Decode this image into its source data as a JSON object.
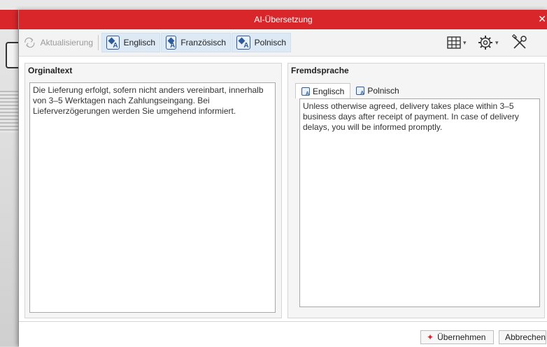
{
  "dialog": {
    "title": "AI-Übersetzung",
    "close_glyph": "✕"
  },
  "toolbar": {
    "refresh_label": "Aktualisierung",
    "languages": [
      {
        "label": "Englisch"
      },
      {
        "label": "Französisch"
      },
      {
        "label": "Polnisch"
      }
    ],
    "caret": "▾"
  },
  "left_panel": {
    "title": "Orginaltext",
    "text": "Die Lieferung erfolgt, sofern nicht anders vereinbart, innerhalb von 3–5 Werktagen nach Zahlungseingang. Bei Lieferverzögerungen werden Sie umgehend informiert."
  },
  "right_panel": {
    "title": "Fremdsprache",
    "tabs": [
      {
        "label": "Englisch",
        "active": true
      },
      {
        "label": "Polnisch",
        "active": false
      }
    ],
    "text": "Unless otherwise agreed, delivery takes place within 3–5 business days after receipt of payment. In case of delivery delays, you will be informed promptly."
  },
  "footer": {
    "apply_label": "Übernehmen",
    "cancel_label": "Abbrechen"
  },
  "colors": {
    "accent": "#d8262b",
    "selected_bg": "#dde9f5",
    "icon_blue": "#2d5a9a"
  }
}
